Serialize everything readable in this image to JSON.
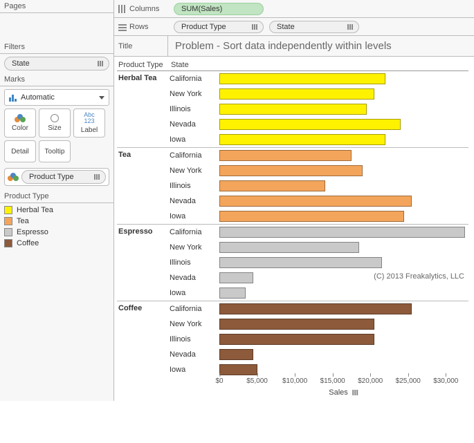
{
  "sidebar": {
    "pages_label": "Pages",
    "filters_label": "Filters",
    "filters_pill": "State",
    "marks_label": "Marks",
    "mark_type": "Automatic",
    "buttons": {
      "color": "Color",
      "size": "Size",
      "label": "Label",
      "detail": "Detail",
      "tooltip": "Tooltip"
    },
    "color_pill": "Product Type",
    "legend_title": "Product Type",
    "legend_items": [
      {
        "label": "Herbal Tea",
        "color": "#fff200"
      },
      {
        "label": "Tea",
        "color": "#f3a55b"
      },
      {
        "label": "Espresso",
        "color": "#c9c9c9"
      },
      {
        "label": "Coffee",
        "color": "#8d5a3b"
      }
    ]
  },
  "shelves": {
    "columns_label": "Columns",
    "rows_label": "Rows",
    "columns_pill": "SUM(Sales)",
    "rows_pill_1": "Product Type",
    "rows_pill_2": "State"
  },
  "title_label": "Title",
  "title_value": "Problem - Sort data independently within levels",
  "viz_headers": {
    "product_type": "Product Type",
    "state": "State"
  },
  "axis_label": "Sales",
  "copyright": "(C) 2013 Freakalytics, LLC",
  "colors": {
    "Herbal Tea": "#fff200",
    "Tea": "#f3a55b",
    "Espresso": "#c9c9c9",
    "Coffee": "#8d5a3b"
  },
  "chart_data": {
    "type": "bar",
    "xlabel": "Sales",
    "ylabel": "",
    "xlim": [
      0,
      33000
    ],
    "ticks": [
      0,
      5000,
      10000,
      15000,
      20000,
      25000,
      30000
    ],
    "tick_labels": [
      "$0",
      "$5,000",
      "$10,000",
      "$15,000",
      "$20,000",
      "$25,000",
      "$30,000"
    ],
    "series": [
      {
        "name": "Herbal Tea",
        "data": [
          {
            "state": "California",
            "value": 22000
          },
          {
            "state": "New York",
            "value": 20500
          },
          {
            "state": "Illinois",
            "value": 19500
          },
          {
            "state": "Nevada",
            "value": 24000
          },
          {
            "state": "Iowa",
            "value": 22000
          }
        ]
      },
      {
        "name": "Tea",
        "data": [
          {
            "state": "California",
            "value": 17500
          },
          {
            "state": "New York",
            "value": 19000
          },
          {
            "state": "Illinois",
            "value": 14000
          },
          {
            "state": "Nevada",
            "value": 25500
          },
          {
            "state": "Iowa",
            "value": 24500
          }
        ]
      },
      {
        "name": "Espresso",
        "data": [
          {
            "state": "California",
            "value": 32500
          },
          {
            "state": "New York",
            "value": 18500
          },
          {
            "state": "Illinois",
            "value": 21500
          },
          {
            "state": "Nevada",
            "value": 4500
          },
          {
            "state": "Iowa",
            "value": 3500
          }
        ]
      },
      {
        "name": "Coffee",
        "data": [
          {
            "state": "California",
            "value": 25500
          },
          {
            "state": "New York",
            "value": 20500
          },
          {
            "state": "Illinois",
            "value": 20500
          },
          {
            "state": "Nevada",
            "value": 4500
          },
          {
            "state": "Iowa",
            "value": 5000
          }
        ]
      }
    ]
  }
}
